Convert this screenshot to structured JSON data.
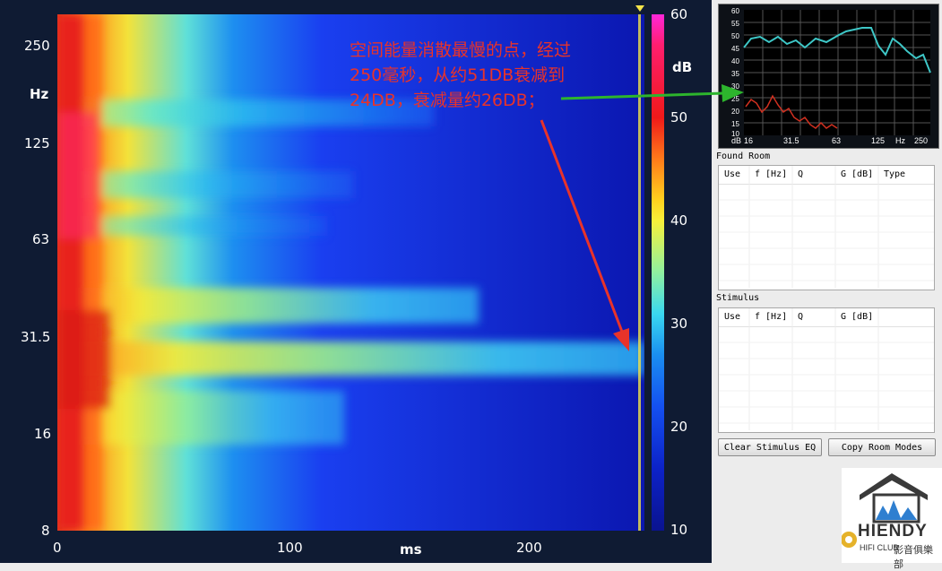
{
  "spectrogram": {
    "y_ticks": [
      "250",
      "125",
      "63",
      "31.5",
      "16",
      "8"
    ],
    "y_unit": "Hz",
    "x_ticks": [
      "0",
      "100",
      "200"
    ],
    "x_unit": "ms",
    "colorbar_ticks": [
      "60",
      "50",
      "40",
      "30",
      "20",
      "10"
    ],
    "colorbar_unit": "dB"
  },
  "annotation": {
    "line1": "空间能量消散最慢的点，经过",
    "line2": "250毫秒，从约51DB衰减到",
    "line3": "24DB，衰减量约26DB；"
  },
  "mini_chart": {
    "y_ticks": [
      "60",
      "55",
      "50",
      "45",
      "40",
      "35",
      "30",
      "25",
      "20",
      "15",
      "10"
    ],
    "x_ticks": [
      "16",
      "31.5",
      "63",
      "125",
      "Hz",
      "250"
    ],
    "unit": "dB",
    "colors": {
      "upper": "#3ec7c7",
      "lower": "#d03020"
    }
  },
  "found_room": {
    "title": "Found Room",
    "columns": [
      "Use",
      "f [Hz]",
      "Q",
      "G [dB]",
      "Type"
    ]
  },
  "stimulus": {
    "title": "Stimulus",
    "columns": [
      "Use",
      "f [Hz]",
      "Q",
      "G [dB]"
    ]
  },
  "buttons": {
    "clear": "Clear Stimulus EQ",
    "copy": "Copy Room Modes"
  },
  "logo": {
    "brand": "HIENDY",
    "sub": "HIFI CLUB",
    "cn": "影音俱樂部"
  }
}
